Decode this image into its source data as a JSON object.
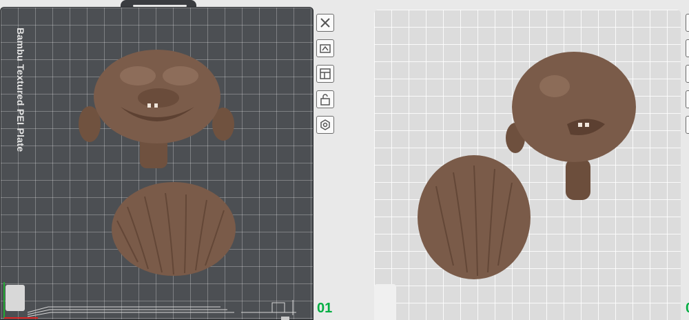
{
  "plate_left": {
    "label": "Bambu Textured PEI Plate",
    "number": "01"
  },
  "toolbar": [
    {
      "icon": "close-icon"
    },
    {
      "icon": "auto-orient-icon"
    },
    {
      "icon": "arrange-icon"
    },
    {
      "icon": "lock-open-icon"
    },
    {
      "icon": "settings-hex-icon"
    }
  ],
  "plate_right": {
    "number": "0"
  },
  "colors": {
    "plate_dark": "#4c4f53",
    "plate_light": "#dcdcdc",
    "model": "#7a5c4b",
    "accent": "#00ae42"
  }
}
